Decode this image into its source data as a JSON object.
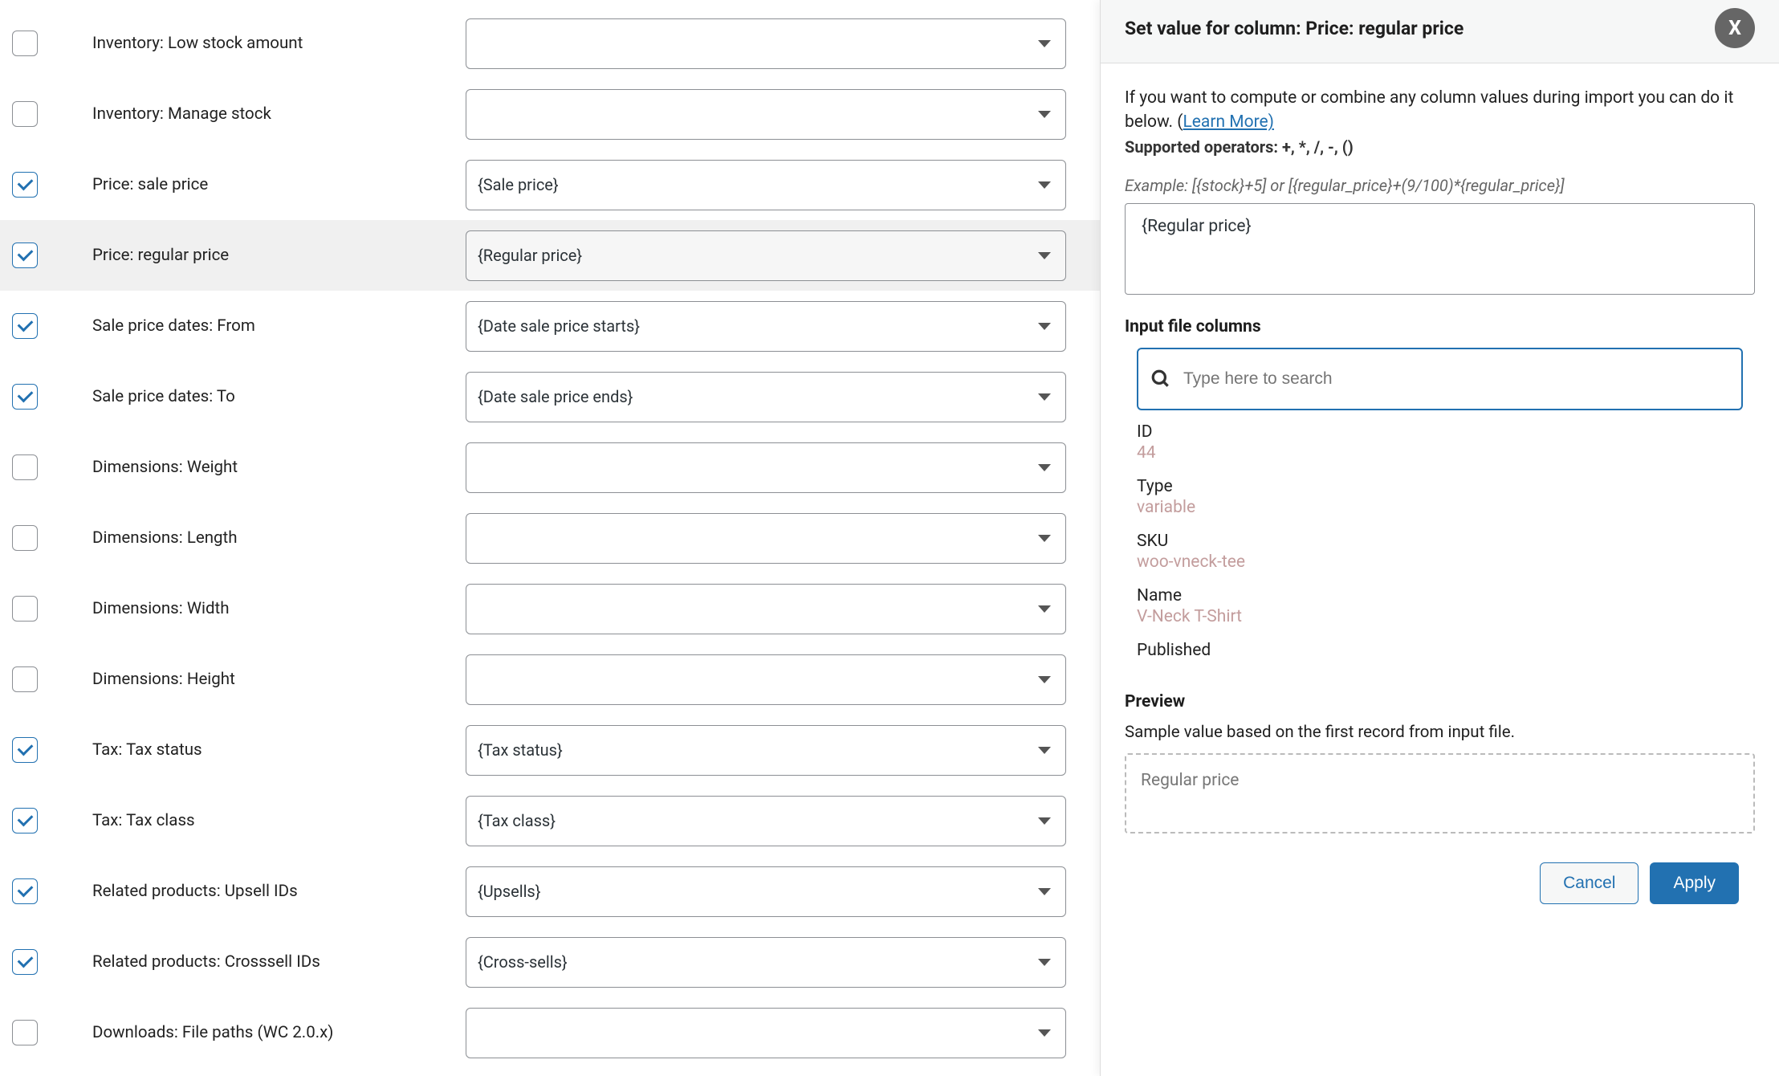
{
  "rows": [
    {
      "checked": false,
      "label": "Inventory: Low stock amount",
      "value": ""
    },
    {
      "checked": false,
      "label": "Inventory: Manage stock",
      "value": ""
    },
    {
      "checked": true,
      "label": "Price: sale price",
      "value": "{Sale price}"
    },
    {
      "checked": true,
      "label": "Price: regular price",
      "value": "{Regular price}",
      "selected": true
    },
    {
      "checked": true,
      "label": "Sale price dates: From",
      "value": "{Date sale price starts}"
    },
    {
      "checked": true,
      "label": "Sale price dates: To",
      "value": "{Date sale price ends}"
    },
    {
      "checked": false,
      "label": "Dimensions: Weight",
      "value": ""
    },
    {
      "checked": false,
      "label": "Dimensions: Length",
      "value": ""
    },
    {
      "checked": false,
      "label": "Dimensions: Width",
      "value": ""
    },
    {
      "checked": false,
      "label": "Dimensions: Height",
      "value": ""
    },
    {
      "checked": true,
      "label": "Tax: Tax status",
      "value": "{Tax status}"
    },
    {
      "checked": true,
      "label": "Tax: Tax class",
      "value": "{Tax class}"
    },
    {
      "checked": true,
      "label": "Related products: Upsell IDs",
      "value": "{Upsells}"
    },
    {
      "checked": true,
      "label": "Related products: Crosssell IDs",
      "value": "{Cross-sells}"
    },
    {
      "checked": false,
      "label": "Downloads: File paths (WC 2.0.x)",
      "value": ""
    }
  ],
  "panel": {
    "title": "Set value for column: Price: regular price",
    "close": "X",
    "intro_1": "If you want to compute or combine any column values during import you can do it below. (",
    "learn_more": "Learn More)",
    "supported": "Supported operators: +, *, /, -, ()",
    "example": "Example: [{stock}+5] or [{regular_price}+(9/100)*{regular_price}]",
    "expression": "{Regular price}",
    "input_cols_label": "Input file columns",
    "search_placeholder": "Type here to search",
    "columns": [
      {
        "key": "ID",
        "val": "44"
      },
      {
        "key": "Type",
        "val": "variable"
      },
      {
        "key": "SKU",
        "val": "woo-vneck-tee"
      },
      {
        "key": "Name",
        "val": "V-Neck T-Shirt"
      },
      {
        "key": "Published",
        "val": ""
      }
    ],
    "preview_label": "Preview",
    "preview_desc": "Sample value based on the first record from input file.",
    "preview_value": "Regular price",
    "cancel": "Cancel",
    "apply": "Apply"
  }
}
